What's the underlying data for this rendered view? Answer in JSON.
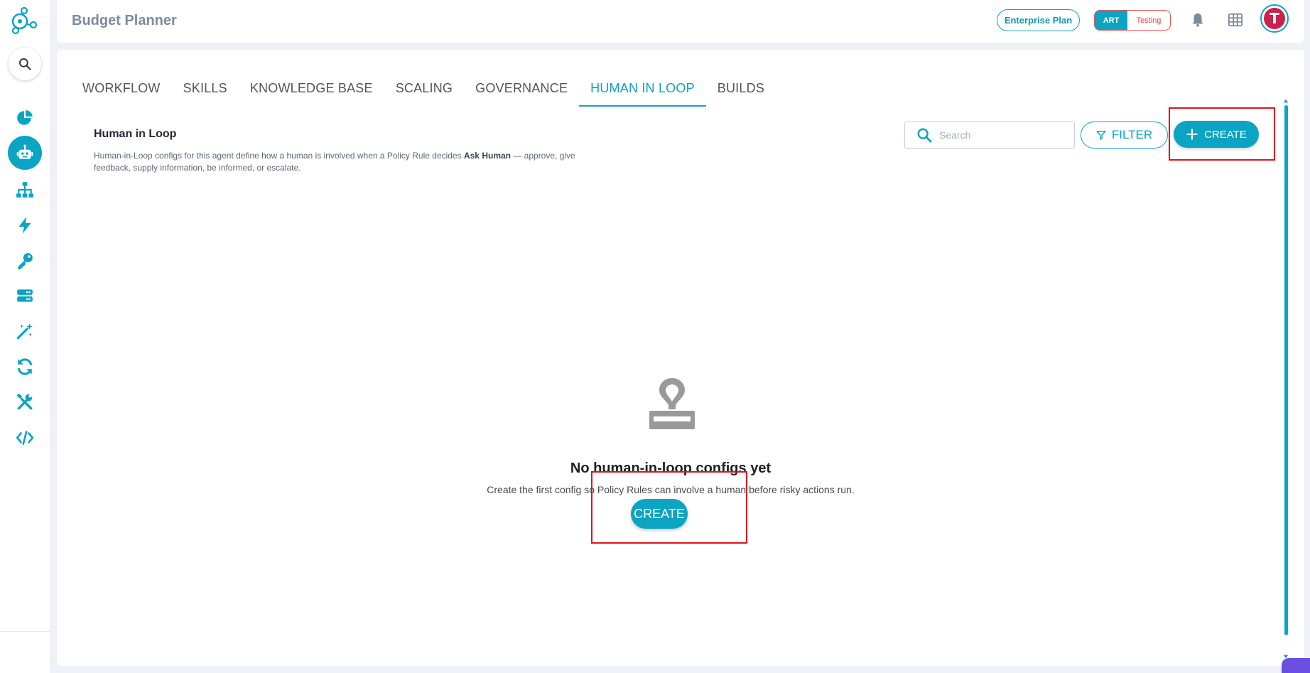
{
  "app": {
    "title": "Budget Planner"
  },
  "header": {
    "plan_label": "Enterprise Plan",
    "env_active": "ART",
    "env_inactive": "Testing",
    "avatar_initial": "T"
  },
  "sidebar": {
    "items": [
      {
        "icon": "pie-chart-icon"
      },
      {
        "icon": "robot-icon",
        "active": true
      },
      {
        "icon": "sitemap-icon"
      },
      {
        "icon": "lightning-icon"
      },
      {
        "icon": "key-icon"
      },
      {
        "icon": "server-icon"
      },
      {
        "icon": "magic-wand-icon"
      },
      {
        "icon": "sync-icon"
      },
      {
        "icon": "tools-icon"
      },
      {
        "icon": "code-icon"
      }
    ]
  },
  "tabs": [
    {
      "label": "WORKFLOW"
    },
    {
      "label": "SKILLS"
    },
    {
      "label": "KNOWLEDGE BASE"
    },
    {
      "label": "SCALING"
    },
    {
      "label": "GOVERNANCE"
    },
    {
      "label": "HUMAN IN LOOP",
      "active": true
    },
    {
      "label": "BUILDS"
    }
  ],
  "section": {
    "title": "Human in Loop",
    "desc_before": "Human-in-Loop configs for this agent define how a human is involved when a Policy Rule decides ",
    "desc_bold": "Ask Human",
    "desc_after": " — approve, give feedback, supply information, be informed, or escalate."
  },
  "toolbar": {
    "search_placeholder": "Search",
    "filter_label": "FILTER",
    "create_label": "CREATE"
  },
  "empty_state": {
    "title": "No human-in-loop configs yet",
    "description": "Create the first config so Policy Rules can involve a human before risky actions run.",
    "create_label": "CREATE"
  },
  "colors": {
    "accent": "#0ba4c2",
    "highlight": "#e0141b",
    "testing": "#e04848"
  }
}
